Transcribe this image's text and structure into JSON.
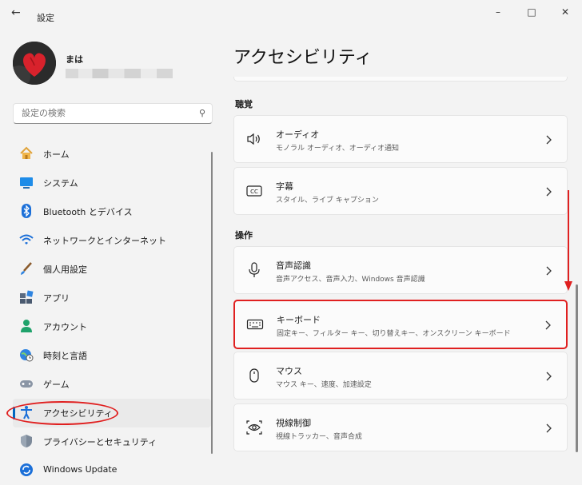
{
  "window": {
    "title": "設定",
    "back_glyph": "←",
    "minimize_glyph": "–",
    "maximize_glyph": "□",
    "close_glyph": "✕"
  },
  "user": {
    "name": "まは"
  },
  "search": {
    "placeholder": "設定の検索"
  },
  "sidebar": {
    "items": [
      {
        "label": "ホーム",
        "icon": "home-icon"
      },
      {
        "label": "システム",
        "icon": "system-icon"
      },
      {
        "label": "Bluetooth とデバイス",
        "icon": "bluetooth-icon"
      },
      {
        "label": "ネットワークとインターネット",
        "icon": "wifi-icon"
      },
      {
        "label": "個人用設定",
        "icon": "brush-icon"
      },
      {
        "label": "アプリ",
        "icon": "apps-icon"
      },
      {
        "label": "アカウント",
        "icon": "account-icon"
      },
      {
        "label": "時刻と言語",
        "icon": "globe-clock-icon"
      },
      {
        "label": "ゲーム",
        "icon": "gamepad-icon"
      },
      {
        "label": "アクセシビリティ",
        "icon": "accessibility-icon",
        "selected": true
      },
      {
        "label": "プライバシーとセキュリティ",
        "icon": "shield-icon"
      },
      {
        "label": "Windows Update",
        "icon": "update-icon"
      }
    ]
  },
  "main": {
    "title": "アクセシビリティ",
    "sections": [
      {
        "heading": "聴覚",
        "cards": [
          {
            "title": "オーディオ",
            "subtitle": "モノラル オーディオ、オーディオ通知",
            "icon": "speaker-icon"
          },
          {
            "title": "字幕",
            "subtitle": "スタイル、ライブ キャプション",
            "icon": "cc-icon"
          }
        ]
      },
      {
        "heading": "操作",
        "cards": [
          {
            "title": "音声認識",
            "subtitle": "音声アクセス、音声入力、Windows 音声認識",
            "icon": "microphone-icon"
          },
          {
            "title": "キーボード",
            "subtitle": "固定キー、フィルター キー、切り替えキー、オンスクリーン キーボード",
            "icon": "keyboard-icon",
            "highlighted": true
          },
          {
            "title": "マウス",
            "subtitle": "マウス キー、速度、加速設定",
            "icon": "mouse-icon"
          },
          {
            "title": "視線制御",
            "subtitle": "視線トラッカー、音声合成",
            "icon": "eye-control-icon"
          }
        ]
      }
    ]
  },
  "colors": {
    "accent": "#0067c0",
    "annotation_red": "#e02020"
  }
}
